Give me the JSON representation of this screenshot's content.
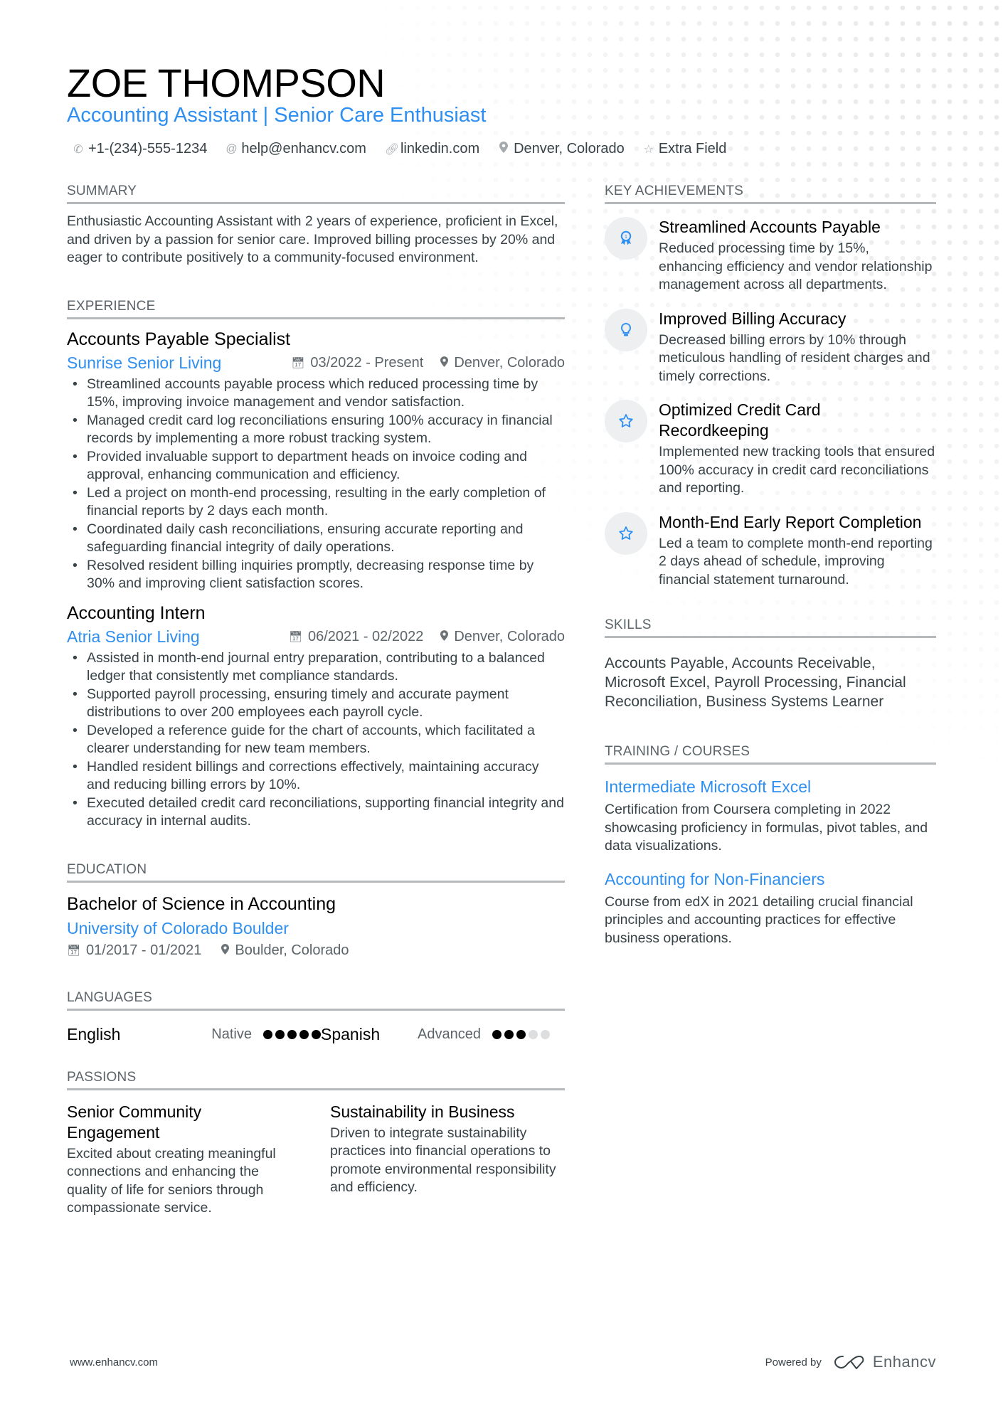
{
  "header": {
    "name": "ZOE THOMPSON",
    "title": "Accounting Assistant | Senior Care Enthusiast",
    "contacts": [
      {
        "icon": "phone-icon",
        "text": "+1-(234)-555-1234"
      },
      {
        "icon": "at-icon",
        "text": "help@enhancv.com"
      },
      {
        "icon": "link-icon",
        "text": "linkedin.com"
      },
      {
        "icon": "location-pin-icon",
        "text": "Denver, Colorado"
      },
      {
        "icon": "star-icon",
        "text": "Extra Field"
      }
    ]
  },
  "summary": {
    "heading": "SUMMARY",
    "text": "Enthusiastic Accounting Assistant with 2 years of experience, proficient in Excel, and driven by a passion for senior care. Improved billing processes by 20% and eager to contribute positively to a community-focused environment."
  },
  "experience": {
    "heading": "EXPERIENCE",
    "jobs": [
      {
        "title": "Accounts Payable Specialist",
        "company": "Sunrise Senior Living",
        "dates": "03/2022 - Present",
        "location": "Denver, Colorado",
        "bullets": [
          "Streamlined accounts payable process which reduced processing time by 15%, improving invoice management and vendor satisfaction.",
          "Managed credit card log reconciliations ensuring 100% accuracy in financial records by implementing a more robust tracking system.",
          "Provided invaluable support to department heads on invoice coding and approval, enhancing communication and efficiency.",
          "Led a project on month-end processing, resulting in the early completion of financial reports by 2 days each month.",
          "Coordinated daily cash reconciliations, ensuring accurate reporting and safeguarding financial integrity of daily operations.",
          "Resolved resident billing inquiries promptly, decreasing response time by 30% and improving client satisfaction scores."
        ]
      },
      {
        "title": "Accounting Intern",
        "company": "Atria Senior Living",
        "dates": "06/2021 - 02/2022",
        "location": "Denver, Colorado",
        "bullets": [
          "Assisted in month-end journal entry preparation, contributing to a balanced ledger that consistently met compliance standards.",
          "Supported payroll processing, ensuring timely and accurate payment distributions to over 200 employees each payroll cycle.",
          "Developed a reference guide for the chart of accounts, which facilitated a clearer understanding for new team members.",
          "Handled resident billings and corrections effectively, maintaining accuracy and reducing billing errors by 10%.",
          "Executed detailed credit card reconciliations, supporting financial integrity and accuracy in internal audits."
        ]
      }
    ]
  },
  "education": {
    "heading": "EDUCATION",
    "degree": "Bachelor of Science in Accounting",
    "school": "University of Colorado Boulder",
    "dates": "01/2017 - 01/2021",
    "location": "Boulder, Colorado"
  },
  "languages": {
    "heading": "LANGUAGES",
    "items": [
      {
        "name": "English",
        "level": "Native",
        "rating": 5,
        "max": 5
      },
      {
        "name": "Spanish",
        "level": "Advanced",
        "rating": 3,
        "max": 5
      }
    ]
  },
  "passions": {
    "heading": "PASSIONS",
    "items": [
      {
        "title": "Senior Community Engagement",
        "desc": "Excited about creating meaningful connections and enhancing the quality of life for seniors through compassionate service."
      },
      {
        "title": "Sustainability in Business",
        "desc": "Driven to integrate sustainability practices into financial operations to promote environmental responsibility and efficiency."
      }
    ]
  },
  "achievements": {
    "heading": "KEY ACHIEVEMENTS",
    "items": [
      {
        "icon": "award-ribbon-icon",
        "title": "Streamlined Accounts Payable",
        "desc": "Reduced processing time by 15%, enhancing efficiency and vendor relationship management across all departments."
      },
      {
        "icon": "lightbulb-icon",
        "title": "Improved Billing Accuracy",
        "desc": "Decreased billing errors by 10% through meticulous handling of resident charges and timely corrections."
      },
      {
        "icon": "star-icon",
        "title": "Optimized Credit Card Recordkeeping",
        "desc": "Implemented new tracking tools that ensured 100% accuracy in credit card reconciliations and reporting."
      },
      {
        "icon": "star-icon",
        "title": "Month-End Early Report Completion",
        "desc": "Led a team to complete month-end reporting 2 days ahead of schedule, improving financial statement turnaround."
      }
    ]
  },
  "skills": {
    "heading": "SKILLS",
    "text": "Accounts Payable, Accounts Receivable, Microsoft Excel, Payroll Processing, Financial Reconciliation, Business Systems Learner"
  },
  "training": {
    "heading": "TRAINING / COURSES",
    "items": [
      {
        "title": "Intermediate Microsoft Excel",
        "desc": "Certification from Coursera completing in 2022 showcasing proficiency in formulas, pivot tables, and data visualizations."
      },
      {
        "title": "Accounting for Non-Financiers",
        "desc": "Course from edX in 2021 detailing crucial financial principles and accounting practices for effective business operations."
      }
    ]
  },
  "footer": {
    "url": "www.enhancv.com",
    "powered_by": "Powered by",
    "brand": "Enhancv"
  },
  "colors": {
    "accent": "#2e8ff0",
    "text": "#384347",
    "heading": "#000000",
    "rule": "#b6b9bc"
  }
}
